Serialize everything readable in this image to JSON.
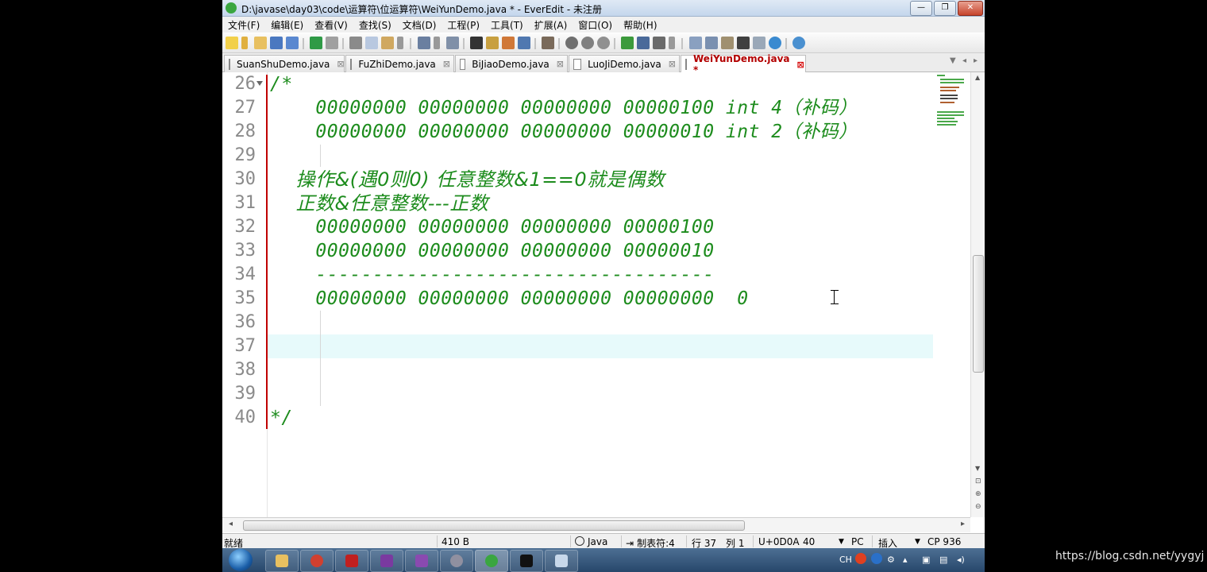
{
  "window": {
    "title": "D:\\javase\\day03\\code\\运算符\\位运算符\\WeiYunDemo.java * - EverEdit - 未注册"
  },
  "menu": [
    "文件(F)",
    "编辑(E)",
    "查看(V)",
    "查找(S)",
    "文档(D)",
    "工程(P)",
    "工具(T)",
    "扩展(A)",
    "窗口(O)",
    "帮助(H)"
  ],
  "tabs": [
    {
      "label": "SuanShuDemo.java",
      "active": false
    },
    {
      "label": "FuZhiDemo.java",
      "active": false
    },
    {
      "label": "BiJiaoDemo.java",
      "active": false
    },
    {
      "label": "LuoJiDemo.java",
      "active": false
    },
    {
      "label": "WeiYunDemo.java *",
      "active": true
    }
  ],
  "tab_close_glyph": "⊠",
  "editor": {
    "line_numbers": [
      "26",
      "27",
      "28",
      "29",
      "30",
      "31",
      "32",
      "33",
      "34",
      "35",
      "36",
      "37",
      "38",
      "39",
      "40"
    ],
    "lines": [
      "/*",
      "    00000000 00000000 00000000 00000100 int 4（补码）",
      "    00000000 00000000 00000000 00000010 int 2（补码）",
      "",
      "    操作&(遇0则0) 任意整数&1==0就是偶数",
      "    正数&任意整数---正数",
      "    00000000 00000000 00000000 00000100",
      "    00000000 00000000 00000000 00000010",
      "    -----------------------------------",
      "    00000000 00000000 00000000 00000000  0",
      "",
      "",
      "",
      "",
      "*/"
    ],
    "current_line": "37",
    "code_color": "#1d8c1d"
  },
  "status": {
    "ready": "就绪",
    "size": "410 B",
    "language": "Java",
    "tab_setting": "制表符:4",
    "row": "行 37",
    "col": "列 1",
    "char_code": "U+0D0A",
    "value": "40",
    "line_ending": "PC",
    "insert_mode": "插入",
    "codepage": "CP 936"
  },
  "taskbar": {
    "tray_lang": "CH"
  },
  "watermark": "https://blog.csdn.net/yygyj"
}
